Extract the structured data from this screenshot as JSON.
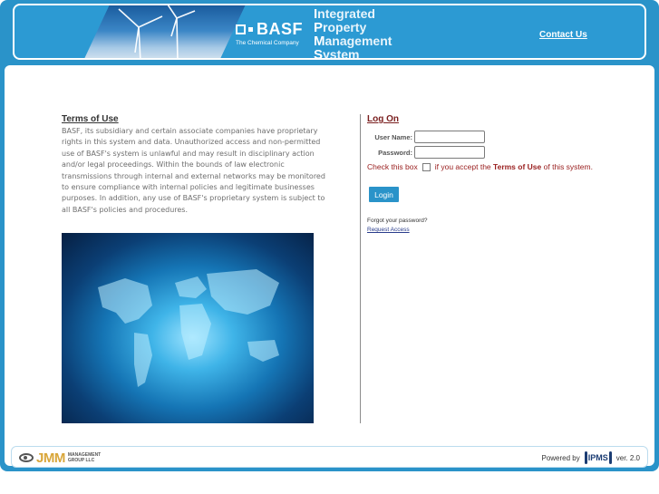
{
  "header": {
    "brand_mark": "BASF",
    "brand_tagline": "The Chemical Company",
    "system_title_lines": [
      {
        "cap": "I",
        "rest": "ntegrated"
      },
      {
        "cap": "P",
        "rest": "roperty"
      },
      {
        "cap": "M",
        "rest": "anagement"
      },
      {
        "cap": "S",
        "rest": "ystem"
      }
    ],
    "contact_link": "Contact Us"
  },
  "terms": {
    "heading": "Terms of Use",
    "body": "BASF, its subsidiary and certain associate companies have proprietary rights in this system and data. Unauthorized access and non-permitted use of BASF's system is unlawful and may result in disciplinary action and/or legal proceedings. Within the bounds of law electronic transmissions through internal and external networks may be monitored to ensure compliance with internal policies and legitimate businesses purposes. In addition, any use of BASF's proprietary system is subject to all BASF's policies and procedures."
  },
  "logon": {
    "heading": "Log On",
    "username_label": "User Name:",
    "username_value": "",
    "password_label": "Password:",
    "password_value": "",
    "accept_prefix": "Check this box",
    "accept_middle": "if you accept the",
    "accept_terms": "Terms of Use",
    "accept_suffix": "of this system.",
    "login_button": "Login",
    "forgot_text": "Forgot your password?",
    "request_link": "Request Access"
  },
  "footer": {
    "jmm_logo_text": "JMM",
    "jmm_logo_sub_1": "MANAGEMENT",
    "jmm_logo_sub_2": "GROUP LLC",
    "powered_by": "Powered by",
    "ipms_badge": "IPMS",
    "version": "ver. 2.0"
  },
  "colors": {
    "frame": "#2a93c9",
    "header": "#2c9ad3",
    "logon_heading": "#7a1f1f",
    "accept_text": "#9a2020",
    "login_button": "#2a93c9"
  },
  "icons": [
    "wind-turbine-photo",
    "world-map-image",
    "jmm-eye-logo",
    "ipms-logo"
  ]
}
